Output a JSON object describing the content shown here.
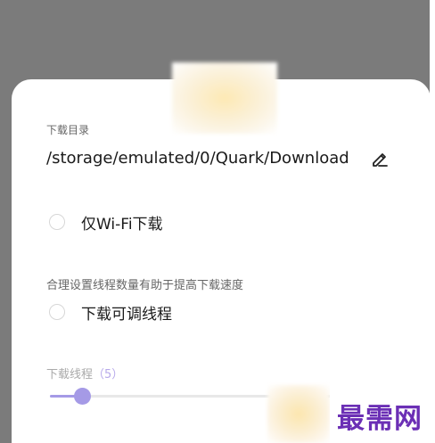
{
  "download_directory": {
    "label": "下载目录",
    "path": "/storage/emulated/0/Quark/Download",
    "edit_icon": "pencil-icon"
  },
  "options": {
    "wifi_only": {
      "label": "仅Wi-Fi下载",
      "checked": false
    },
    "thread_hint": "合理设置线程数量有助于提高下载速度",
    "adjustable_threads": {
      "label": "下载可调线程",
      "checked": false
    }
  },
  "threads": {
    "label": "下载线程",
    "count_text": "（5）",
    "value": 5,
    "level_fraction": 0.1
  },
  "colors": {
    "accent": "#a59ae6",
    "watermark": "#6b2fb5"
  },
  "watermark": {
    "text": "最需网"
  }
}
